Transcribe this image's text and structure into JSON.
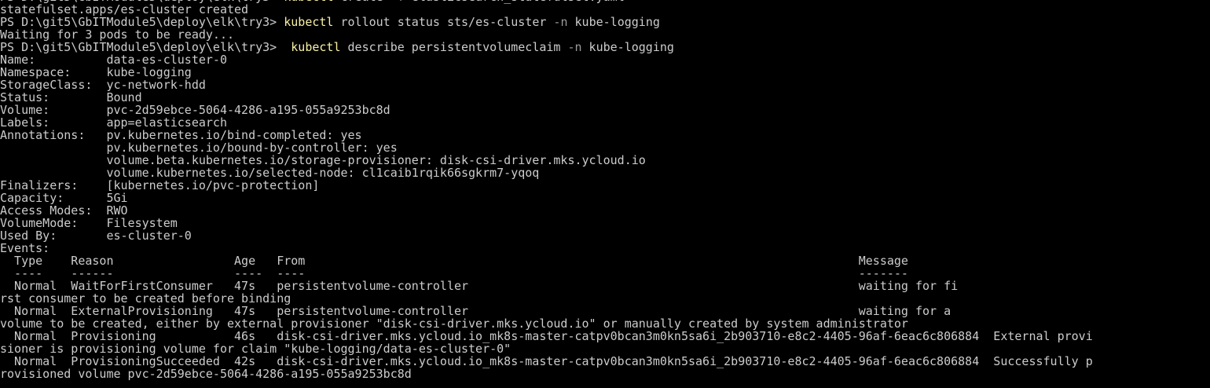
{
  "terminal": {
    "prompt": "PS D:\\git5\\GbITModule5\\deploy\\elk\\try3> ",
    "colors": {
      "background": "#000000",
      "foreground": "#cccccc",
      "command": "#f9f1a5",
      "flag": "#9b9b9b"
    },
    "lines": [
      {
        "type": "cmd",
        "pre": "",
        "cmd": "kubectl",
        "args": [
          {
            "t": " create "
          },
          {
            "t": "-f",
            "flag": true
          },
          {
            "t": " elasticsearch_statefulset.yaml"
          }
        ]
      },
      {
        "type": "out",
        "text": "statefulset.apps/es-cluster created"
      },
      {
        "type": "cmd",
        "pre": "",
        "cmd": "kubectl",
        "args": [
          {
            "t": " rollout status sts/es-cluster "
          },
          {
            "t": "-n",
            "flag": true
          },
          {
            "t": " kube-logging"
          }
        ]
      },
      {
        "type": "out",
        "text": "Waiting for 3 pods to be ready..."
      },
      {
        "type": "cmd",
        "pre": " ",
        "cmd": "kubectl",
        "args": [
          {
            "t": " describe persistentvolumeclaim "
          },
          {
            "t": "-n",
            "flag": true
          },
          {
            "t": " kube-logging"
          }
        ]
      },
      {
        "type": "out",
        "text": "Name:          data-es-cluster-0"
      },
      {
        "type": "out",
        "text": "Namespace:     kube-logging"
      },
      {
        "type": "out",
        "text": "StorageClass:  yc-network-hdd"
      },
      {
        "type": "out",
        "text": "Status:        Bound"
      },
      {
        "type": "out",
        "text": "Volume:        pvc-2d59ebce-5064-4286-a195-055a9253bc8d"
      },
      {
        "type": "out",
        "text": "Labels:        app=elasticsearch"
      },
      {
        "type": "out",
        "text": "Annotations:   pv.kubernetes.io/bind-completed: yes"
      },
      {
        "type": "out",
        "text": "               pv.kubernetes.io/bound-by-controller: yes"
      },
      {
        "type": "out",
        "text": "               volume.beta.kubernetes.io/storage-provisioner: disk-csi-driver.mks.ycloud.io"
      },
      {
        "type": "out",
        "text": "               volume.kubernetes.io/selected-node: cl1caib1rqik66sgkrm7-yqoq"
      },
      {
        "type": "out",
        "text": "Finalizers:    [kubernetes.io/pvc-protection]"
      },
      {
        "type": "out",
        "text": "Capacity:      5Gi"
      },
      {
        "type": "out",
        "text": "Access Modes:  RWO"
      },
      {
        "type": "out",
        "text": "VolumeMode:    Filesystem"
      },
      {
        "type": "out",
        "text": "Used By:       es-cluster-0"
      },
      {
        "type": "out",
        "text": "Events:"
      },
      {
        "type": "out",
        "text": "  Type    Reason                 Age   From                                                                              Message"
      },
      {
        "type": "out",
        "text": "  ----    ------                 ----  ----                                                                              -------"
      },
      {
        "type": "out",
        "text": "  Normal  WaitForFirstConsumer   47s   persistentvolume-controller                                                       waiting for fi"
      },
      {
        "type": "out",
        "text": "rst consumer to be created before binding"
      },
      {
        "type": "out",
        "text": "  Normal  ExternalProvisioning   47s   persistentvolume-controller                                                       waiting for a "
      },
      {
        "type": "out",
        "text": "volume to be created, either by external provisioner \"disk-csi-driver.mks.ycloud.io\" or manually created by system administrator"
      },
      {
        "type": "out",
        "text": "  Normal  Provisioning           46s   disk-csi-driver.mks.ycloud.io_mk8s-master-catpv0bcan3m0kn5sa6i_2b903710-e8c2-4405-96af-6eac6c806884  External provi"
      },
      {
        "type": "out",
        "text": "sioner is provisioning volume for claim \"kube-logging/data-es-cluster-0\""
      },
      {
        "type": "out",
        "text": "  Normal  ProvisioningSucceeded  42s   disk-csi-driver.mks.ycloud.io_mk8s-master-catpv0bcan3m0kn5sa6i_2b903710-e8c2-4405-96af-6eac6c806884  Successfully p"
      },
      {
        "type": "out",
        "text": "rovisioned volume pvc-2d59ebce-5064-4286-a195-055a9253bc8d"
      }
    ]
  }
}
